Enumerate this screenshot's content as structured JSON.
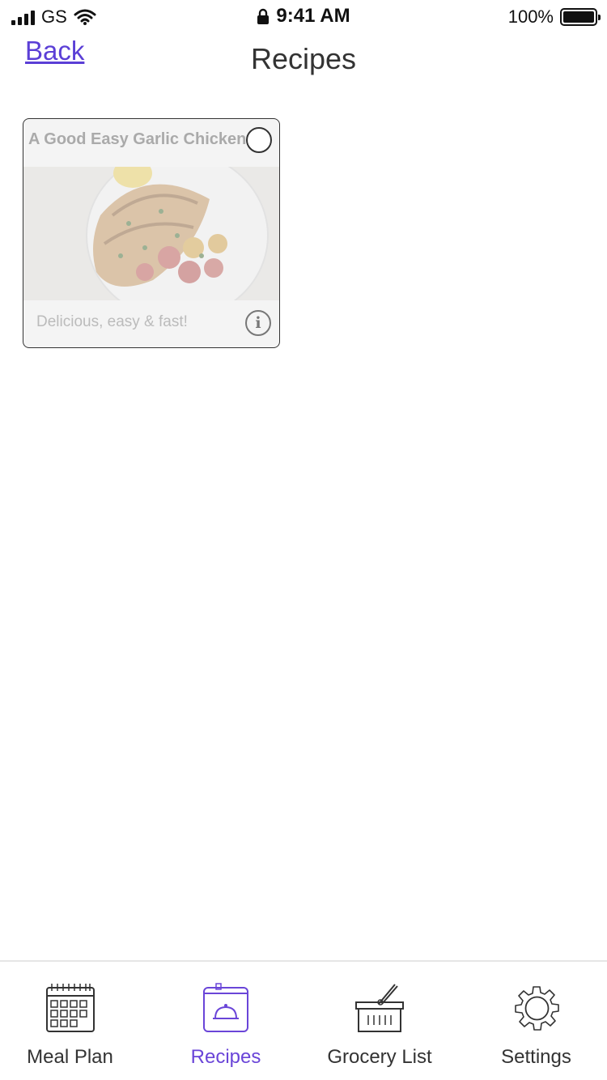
{
  "status_bar": {
    "carrier": "GS",
    "time": "9:41 AM",
    "battery_percent": "100%"
  },
  "header": {
    "back_label": "Back",
    "title": "Recipes"
  },
  "recipes": [
    {
      "title": "A Good Easy Garlic Chicken",
      "description": "Delicious, easy & fast!",
      "selected": false
    }
  ],
  "tab_bar": {
    "tabs": [
      {
        "label": "Meal Plan",
        "icon": "calendar-icon",
        "active": false
      },
      {
        "label": "Recipes",
        "icon": "recipe-book-icon",
        "active": true
      },
      {
        "label": "Grocery List",
        "icon": "basket-icon",
        "active": false
      },
      {
        "label": "Settings",
        "icon": "gear-icon",
        "active": false
      }
    ]
  },
  "colors": {
    "accent": "#5b3fd6",
    "active_tab": "#6a45d8",
    "divider": "#e6e6e6"
  }
}
